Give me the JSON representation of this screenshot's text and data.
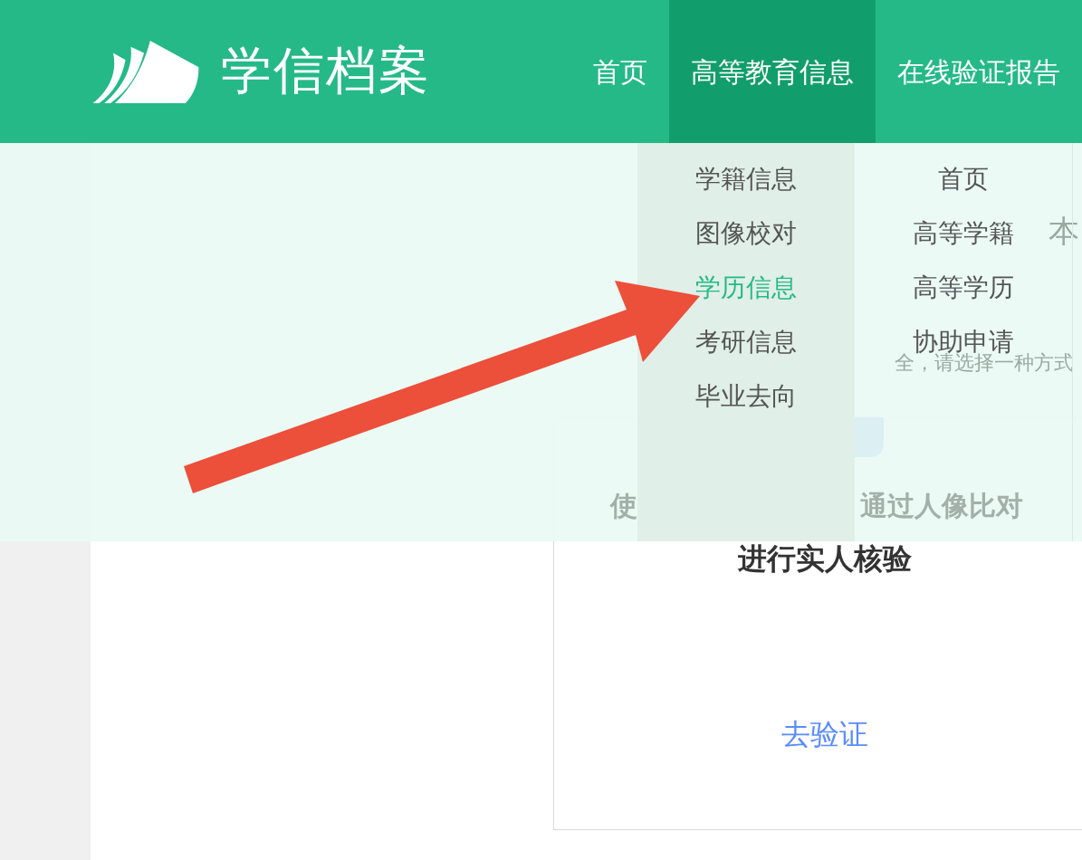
{
  "header": {
    "logo_text": "学信档案",
    "nav": [
      {
        "label": "首页",
        "selected": false
      },
      {
        "label": "高等教育信息",
        "selected": true
      },
      {
        "label": "在线验证报告",
        "selected": false
      }
    ]
  },
  "dropdown": {
    "columns": [
      [
        {
          "label": "学籍信息",
          "selected": false
        },
        {
          "label": "图像校对",
          "selected": false
        },
        {
          "label": "学历信息",
          "selected": true
        },
        {
          "label": "考研信息",
          "selected": false
        },
        {
          "label": "毕业去向",
          "selected": false
        }
      ],
      [
        {
          "label": "首页",
          "selected": false
        },
        {
          "label": "高等学籍",
          "selected": false
        },
        {
          "label": "高等学历",
          "selected": false
        },
        {
          "label": "协助申请",
          "selected": false
        }
      ]
    ]
  },
  "content": {
    "heading_fragment": "本",
    "notice_fragment": "全，请选择一种方式",
    "card": {
      "headline_parts": [
        "使",
        "通过人像比对"
      ],
      "subtitle": "进行实人核验",
      "link": "去验证"
    }
  }
}
